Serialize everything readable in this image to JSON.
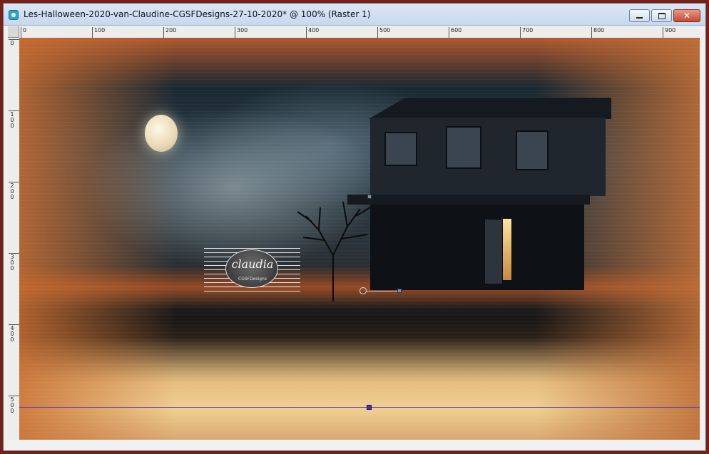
{
  "window": {
    "title": "Les-Halloween-2020-van-Claudine-CGSFDesigns-27-10-2020* @ 100% (Raster 1)",
    "controls": {
      "minimize": "",
      "maximize": "",
      "close": "✕"
    },
    "accent": "#c44a31"
  },
  "ruler": {
    "horizontal_labels": [
      "0",
      "100",
      "200",
      "300",
      "400",
      "500",
      "600",
      "700",
      "800",
      "900"
    ],
    "vertical_labels": [
      "0",
      "1 0 0",
      "2 0 0",
      "3 0 0",
      "4 0 0",
      "5 0 0"
    ]
  },
  "canvas": {
    "logo": {
      "name": "claudia",
      "subtitle": "CGSFDesigns"
    },
    "guide_color": "#5a3cc8"
  }
}
